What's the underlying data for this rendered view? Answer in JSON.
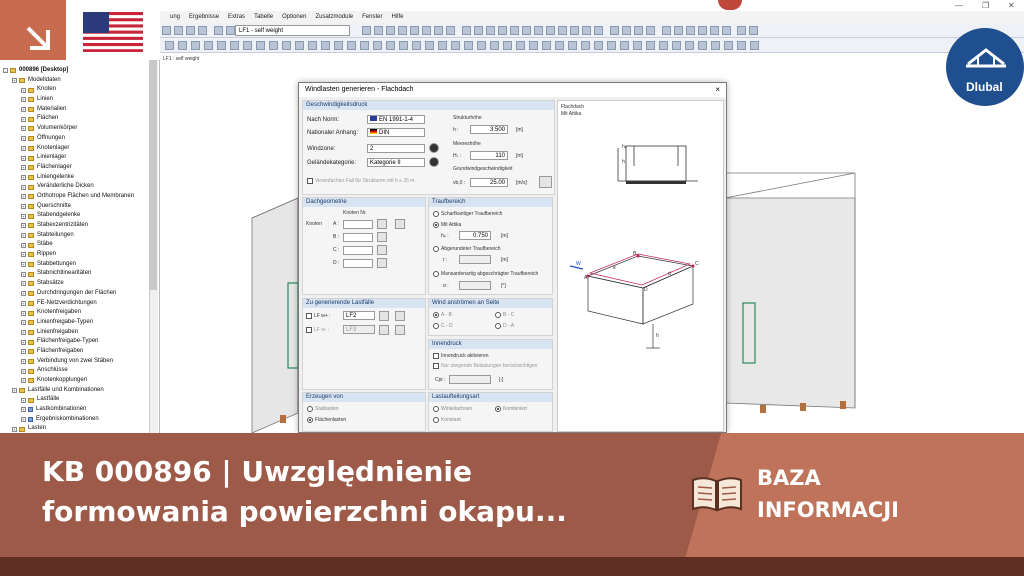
{
  "menu": [
    "ung",
    "Ergebnisse",
    "Extras",
    "Tabelle",
    "Optionen",
    "Zusatzmodule",
    "Fenster",
    "Hilfe"
  ],
  "loadcase_combo": "LF1 - self weight",
  "viewport_label": "LF1 : self weight",
  "tree": {
    "root": "000896 [Desktop]",
    "items": [
      {
        "label": "Modelldaten",
        "level": 1,
        "type": "folder"
      },
      {
        "label": "Knoten",
        "level": 2,
        "type": "folder"
      },
      {
        "label": "Linien",
        "level": 2,
        "type": "folder"
      },
      {
        "label": "Materialien",
        "level": 2,
        "type": "folder"
      },
      {
        "label": "Flächen",
        "level": 2,
        "type": "folder"
      },
      {
        "label": "Volumenkörper",
        "level": 2,
        "type": "folder"
      },
      {
        "label": "Öffnungen",
        "level": 2,
        "type": "folder"
      },
      {
        "label": "Knotenlager",
        "level": 2,
        "type": "folder"
      },
      {
        "label": "Linienlager",
        "level": 2,
        "type": "folder"
      },
      {
        "label": "Flächenlager",
        "level": 2,
        "type": "folder"
      },
      {
        "label": "Liniengelenke",
        "level": 2,
        "type": "folder"
      },
      {
        "label": "Veränderliche Dicken",
        "level": 2,
        "type": "folder"
      },
      {
        "label": "Orthotrope Flächen und Membranen",
        "level": 2,
        "type": "folder"
      },
      {
        "label": "Querschnitte",
        "level": 2,
        "type": "folder"
      },
      {
        "label": "Stabendgelenke",
        "level": 2,
        "type": "folder"
      },
      {
        "label": "Stabexzentrizitäten",
        "level": 2,
        "type": "folder"
      },
      {
        "label": "Stabteilungen",
        "level": 2,
        "type": "folder"
      },
      {
        "label": "Stäbe",
        "level": 2,
        "type": "folder"
      },
      {
        "label": "Rippen",
        "level": 2,
        "type": "folder"
      },
      {
        "label": "Stabbettungen",
        "level": 2,
        "type": "folder"
      },
      {
        "label": "Stabnichtlinearitäten",
        "level": 2,
        "type": "folder"
      },
      {
        "label": "Stabsätze",
        "level": 2,
        "type": "folder"
      },
      {
        "label": "Durchdringungen der Flächen",
        "level": 2,
        "type": "folder"
      },
      {
        "label": "FE-Netzverdichtungen",
        "level": 2,
        "type": "folder"
      },
      {
        "label": "Knotenfreigaben",
        "level": 2,
        "type": "folder"
      },
      {
        "label": "Linienfreigabe-Typen",
        "level": 2,
        "type": "folder"
      },
      {
        "label": "Linienfreigaben",
        "level": 2,
        "type": "folder"
      },
      {
        "label": "Flächenfreigabe-Typen",
        "level": 2,
        "type": "folder"
      },
      {
        "label": "Flächenfreigaben",
        "level": 2,
        "type": "folder"
      },
      {
        "label": "Verbindung von zwei Stäben",
        "level": 2,
        "type": "folder"
      },
      {
        "label": "Anschlüsse",
        "level": 2,
        "type": "folder"
      },
      {
        "label": "Knotenkopplungen",
        "level": 2,
        "type": "folder"
      },
      {
        "label": "Lastfälle und Kombinationen",
        "level": 1,
        "type": "folder"
      },
      {
        "label": "Lastfälle",
        "level": 2,
        "type": "folder"
      },
      {
        "label": "Lastkombinationen",
        "level": 2,
        "type": "leaf"
      },
      {
        "label": "Ergebniskombinationen",
        "level": 2,
        "type": "leaf"
      },
      {
        "label": "Lasten",
        "level": 1,
        "type": "folder"
      }
    ]
  },
  "dialog": {
    "title": "Windlasten generieren  -  Flachdach",
    "close": "×",
    "speed_group": {
      "header": "Geschwindigkeitsdruck",
      "norm_label": "Nach Norm:",
      "norm_value": "EN 1991-1-4",
      "annex_label": "Nationaler Anhang:",
      "annex_value": "DIN",
      "zone_label": "Windzone:",
      "zone_value": "2",
      "terrain_label": "Geländekategorie:",
      "terrain_value": "Kategorie II",
      "simplified": "Vereinfachter Fall für Strukturen mit h ≤ 25 m",
      "struct_height_label": "Strukturhöhe",
      "h_label": "h :",
      "h_value": "3.500",
      "h_unit": "[m]",
      "sea_label": "Meereshöhe",
      "hs_label": "Hₛ :",
      "hs_value": "110",
      "hs_unit": "[m]",
      "basic_label": "Grundwindgeschwindigkeit",
      "vb_label": "vb,0 :",
      "vb_value": "25.00",
      "vb_unit": "[m/s]"
    },
    "roof_geom": {
      "header": "Dachgeometrie",
      "col_header": "Knoten Nr.",
      "row_label": "Knoten",
      "rows": [
        "A :",
        "B :",
        "C :",
        "D :"
      ]
    },
    "eaves": {
      "header": "Traufbereich",
      "opt1": "Scharfkantiger Traufbereich",
      "opt2": "Mit Attika",
      "hp_label": "hₚ :",
      "hp_value": "0.750",
      "hp_unit": "[m]",
      "opt3": "Abgerundeter Traufbereich",
      "r_label": "r :",
      "r_unit": "[m]",
      "opt4": "Mansardenartig abgeschrägter Traufbereich",
      "a_label": "α :",
      "a_unit": "[°]"
    },
    "loadcases": {
      "header": "Zu generierende Lastfälle",
      "lf1_label": "LF w+ :",
      "lf1_value": "LF2",
      "lf2_label": "LF w- :",
      "lf2_value": "LF3"
    },
    "wind_side": {
      "header": "Wind anströmen an Seite",
      "ab": "A - B",
      "bc": "B - C",
      "cd": "C - D",
      "da": "D - A"
    },
    "internal": {
      "header": "Innendruck",
      "activate": "Innendruck aktivieren",
      "only_rising": "Nur steigende Belastungen berücksichtigen",
      "cpi_label": "Cpi :",
      "cpi_unit": "[-]"
    },
    "generate": {
      "header": "Erzeugen von",
      "opt1": "Stablasten",
      "opt2": "Flächenlasten"
    },
    "load_application": {
      "header": "Lastaufteilungsart",
      "opt1": "Winkelachsen",
      "opt2": "Kombiniert",
      "opt3": "Konstant"
    },
    "preview": {
      "title": "Flachdach",
      "subtitle": "Mit Attika",
      "labels": [
        "hₚ",
        "h",
        "A",
        "B",
        "C",
        "D",
        "W",
        "e",
        "d",
        "h"
      ]
    }
  },
  "banner": {
    "title_line1": "KB 000896 | Uwzględnienie",
    "title_line2": "formowania powierzchni okapu...",
    "category_line1": "BAZA",
    "category_line2": "INFORMACJI",
    "brand": "Dlubal"
  },
  "colors": {
    "banner_dark": "#9e5a48",
    "banner_light": "#c0735b",
    "accent_orange": "#c96b4e",
    "dlubal_blue": "#1f4f8f"
  }
}
